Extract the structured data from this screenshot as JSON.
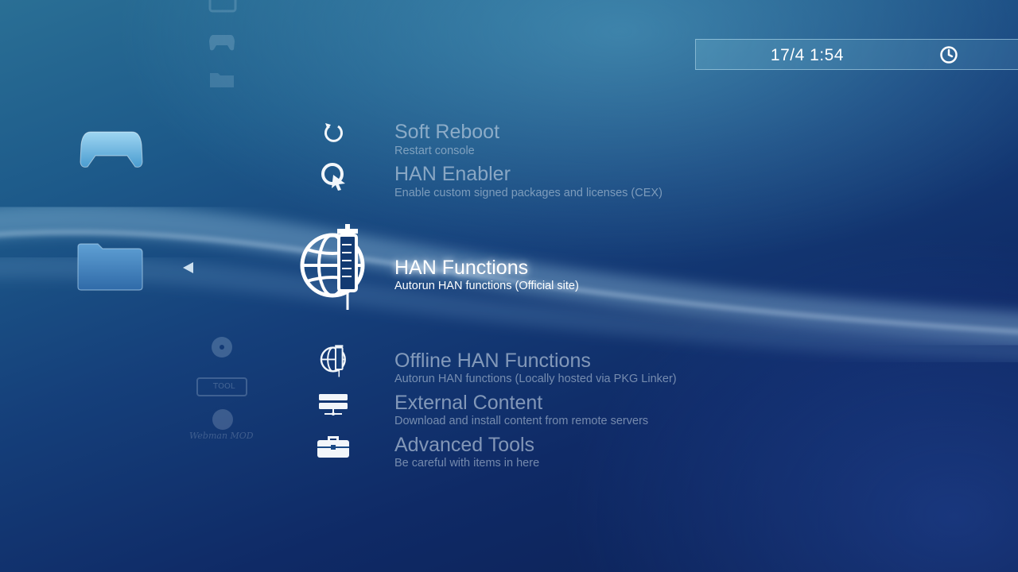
{
  "clock": {
    "date_time": "17/4 1:54",
    "icon": "clock-icon"
  },
  "categories": [
    {
      "name": "tv-category-icon",
      "selected": false
    },
    {
      "name": "game-category-icon",
      "selected": false
    },
    {
      "name": "folder-category-icon",
      "selected": true
    }
  ],
  "menu": {
    "items": [
      {
        "title": "Soft Reboot",
        "subtitle": "Restart console",
        "icon": "reboot-icon"
      },
      {
        "title": "HAN Enabler",
        "subtitle": "Enable custom signed packages and licenses (CEX)",
        "icon": "han-enabler-icon"
      },
      {
        "title": "HAN Functions",
        "subtitle": "Autorun HAN functions (Official site)",
        "icon": "globe-syringe-icon",
        "selected": true
      },
      {
        "title": "Offline HAN Functions",
        "subtitle": "Autorun HAN functions (Locally hosted via PKG Linker)",
        "icon": "globe-syringe-icon"
      },
      {
        "title": "External Content",
        "subtitle": "Download and install content from remote servers",
        "icon": "server-icon"
      },
      {
        "title": "Advanced Tools",
        "subtitle": "Be careful with items in here",
        "icon": "toolbox-icon"
      }
    ]
  },
  "faded_items": [
    {
      "label": "TOOL",
      "icon": "tool-logo-icon"
    },
    {
      "label": "Webman MOD",
      "icon": "webman-logo-icon"
    }
  ],
  "colors": {
    "selected_text": "#ffffff",
    "dim_text": "#c8d7e6",
    "accent": "#3a8fd0"
  }
}
